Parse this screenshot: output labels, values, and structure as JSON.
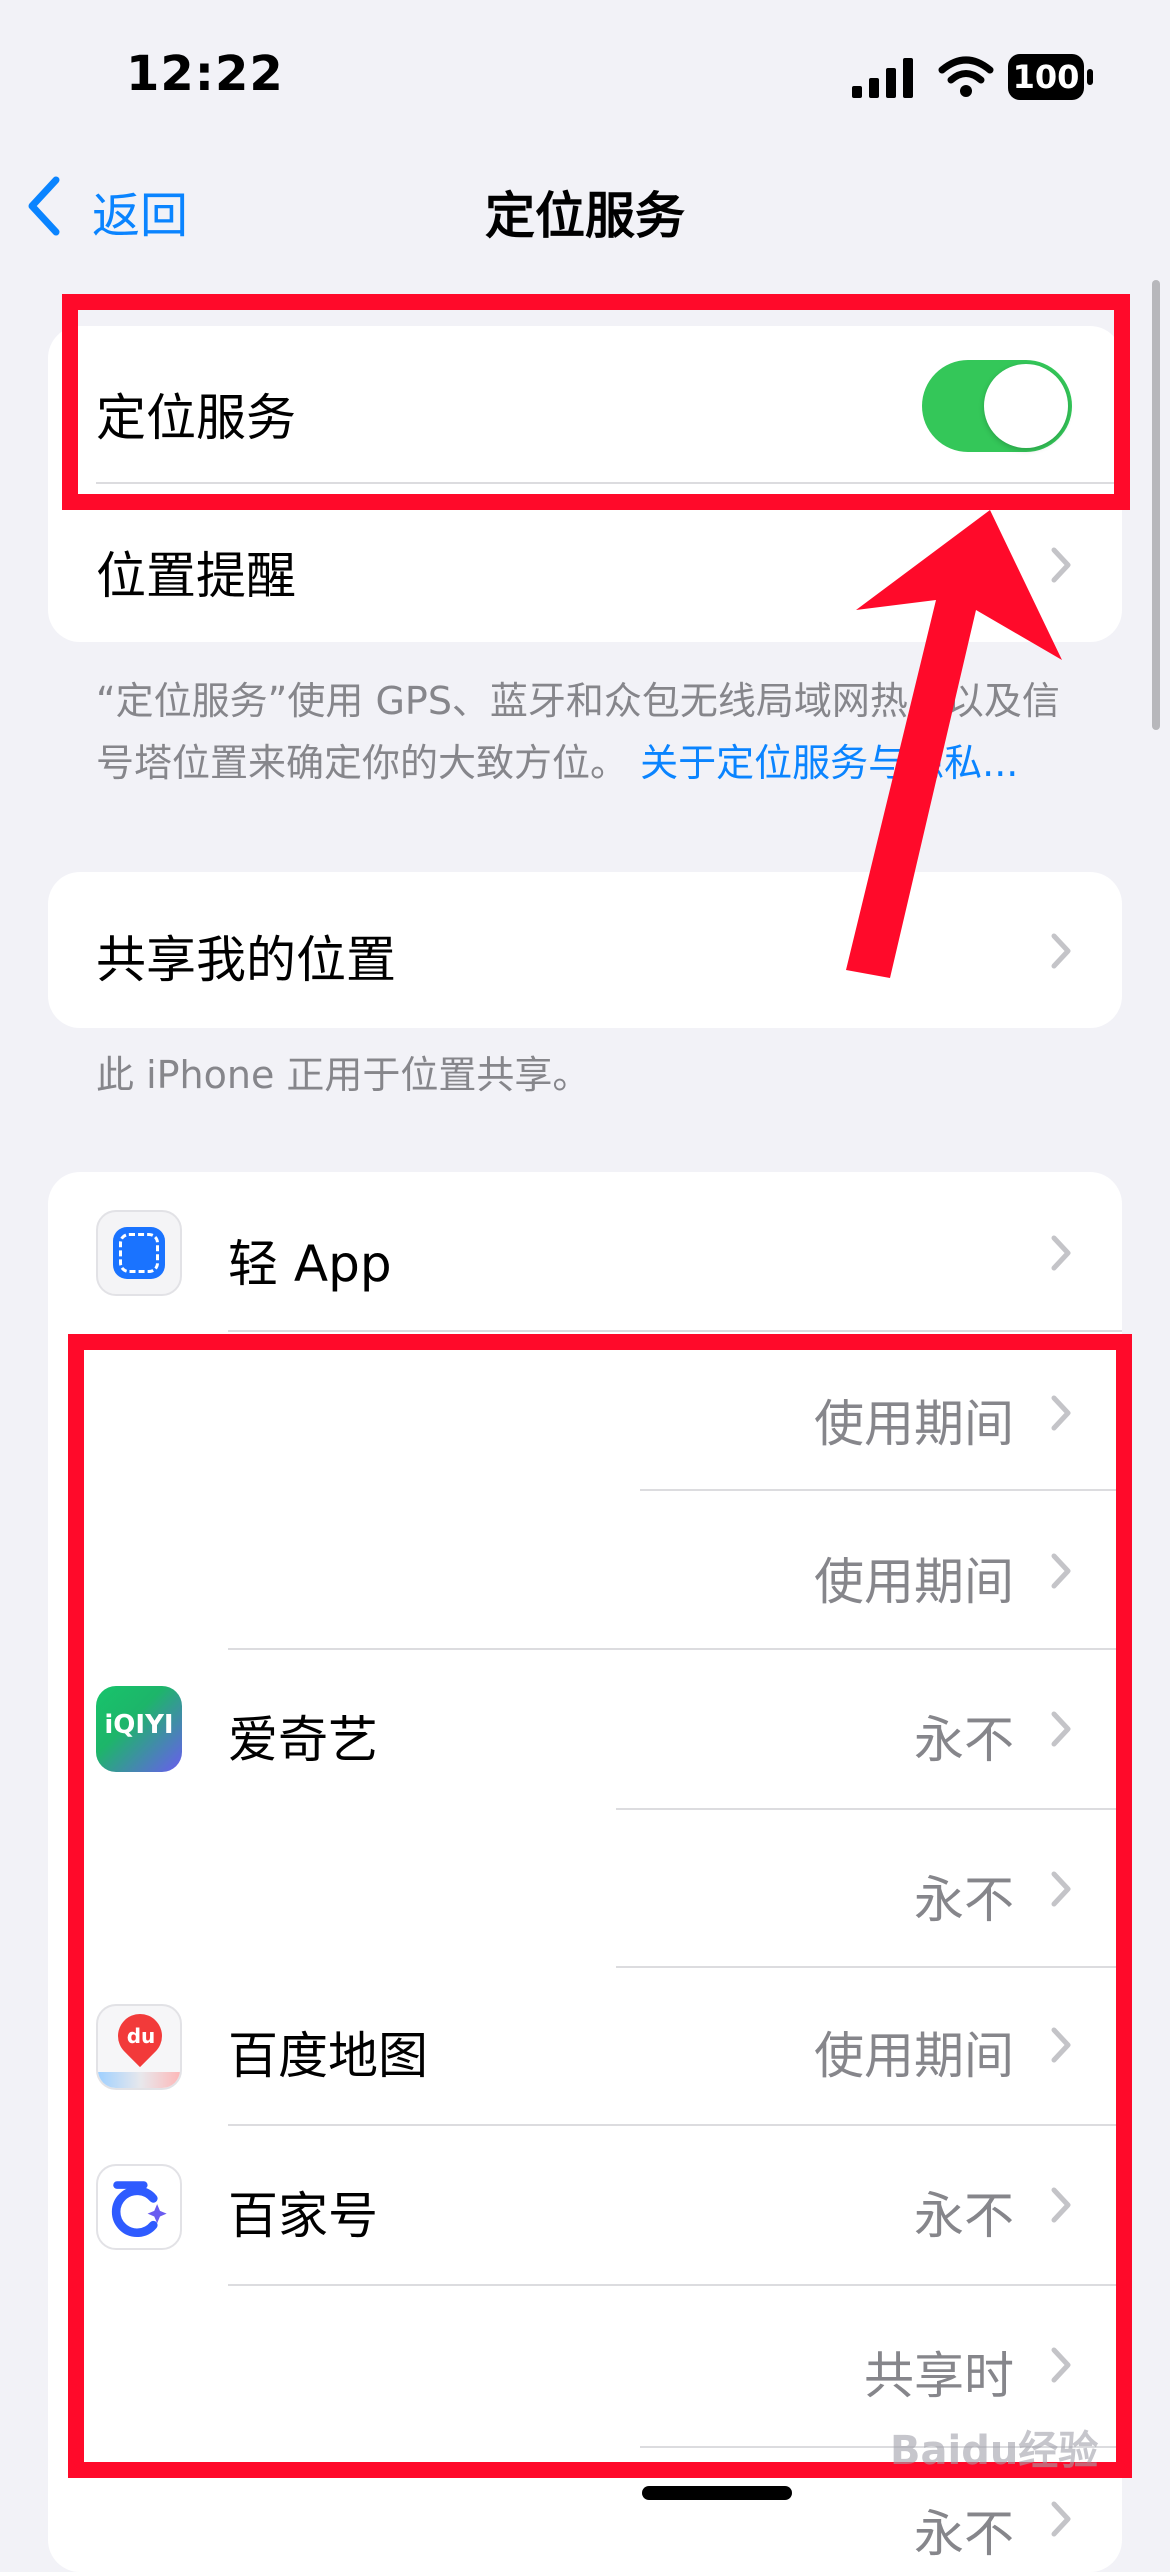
{
  "status_bar": {
    "time": "12:22",
    "battery": "100"
  },
  "nav": {
    "back_label": "返回",
    "title": "定位服务"
  },
  "section1": {
    "location_services_label": "定位服务",
    "location_services_on": true,
    "location_alerts_label": "位置提醒"
  },
  "footnote1": {
    "text": "“定位服务”使用 GPS、蓝牙和众包无线局域网热点以及信号塔位置来确定你的大致方位。",
    "link": "关于定位服务与隐私..."
  },
  "section2": {
    "share_my_location_label": "共享我的位置"
  },
  "footnote2": {
    "text": "此 iPhone 正用于位置共享。"
  },
  "apps": [
    {
      "name": "轻 App",
      "value": ""
    },
    {
      "name": "",
      "value": "使用期间"
    },
    {
      "name": "",
      "value": "使用期间"
    },
    {
      "name": "爱奇艺",
      "value": "永不"
    },
    {
      "name": "",
      "value": "永不"
    },
    {
      "name": "百度地图",
      "value": "使用期间"
    },
    {
      "name": "百家号",
      "value": "永不"
    },
    {
      "name": "",
      "value": "共享时"
    },
    {
      "name": "",
      "value": "永不"
    }
  ],
  "icons": {
    "iqiyi_text": "iQIYI",
    "baidu_map_text": "du"
  },
  "watermark": "Baidu经验",
  "colors": {
    "accent": "#0a84ff",
    "toggle_on": "#34c759",
    "annotation": "#ff0a2a"
  }
}
